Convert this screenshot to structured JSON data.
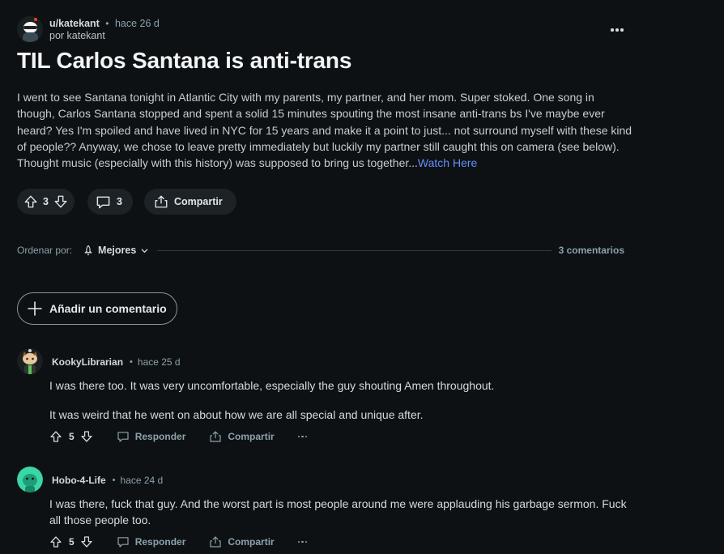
{
  "post": {
    "author": "u/katekant",
    "separator": "•",
    "time": "hace 26 d",
    "by_line": "por katekant",
    "title": "TIL Carlos Santana is anti-trans",
    "body": "I went to see Santana tonight in Atlantic City with my parents, my partner, and her mom. Super stoked. One song in though, Carlos Santana stopped and spent a solid 15 minutes spouting the most insane anti-trans bs I've maybe ever heard? Yes I'm spoiled and have lived in NYC for 15 years and make it a point to just... not surround myself with these kind of people?? Anyway, we chose to leave pretty immediately but luckily my partner still caught this on camera (see below). Thought music (especially with this history) was supposed to bring us together...",
    "link_text": "Watch Here",
    "votes": "3",
    "comments": "3",
    "share_label": "Compartir"
  },
  "sort": {
    "label": "Ordenar por:",
    "value": "Mejores",
    "count": "3 comentarios"
  },
  "add_comment_label": "Añadir un comentario",
  "comments": [
    {
      "author": "KookyLibrarian",
      "separator": "•",
      "time": "hace 25 d",
      "paragraphs": [
        "I was there too. It was very uncomfortable, especially the guy shouting Amen throughout.",
        "It was weird that he went on about how we are all special and unique after."
      ],
      "score": "5",
      "reply_label": "Responder",
      "share_label": "Compartir"
    },
    {
      "author": "Hobo-4-Life",
      "separator": "•",
      "time": "hace 24 d",
      "paragraphs": [
        "I was there, fuck that guy. And the worst part is most people around me were applauding his garbage sermon. Fuck all those people too."
      ],
      "score": "5",
      "reply_label": "Responder",
      "share_label": "Compartir"
    }
  ],
  "colors": {
    "background": "#0e1113",
    "link": "#648efc",
    "pill": "#1c2226",
    "muted": "#8ba2ad"
  },
  "icons": {
    "upvote": "arrow-up-icon",
    "downvote": "arrow-down-icon",
    "comment": "speech-bubble-icon",
    "share": "share-icon",
    "sort": "rocket-icon",
    "chevron": "chevron-down-icon",
    "add": "plus-icon",
    "more": "ellipsis-icon"
  }
}
